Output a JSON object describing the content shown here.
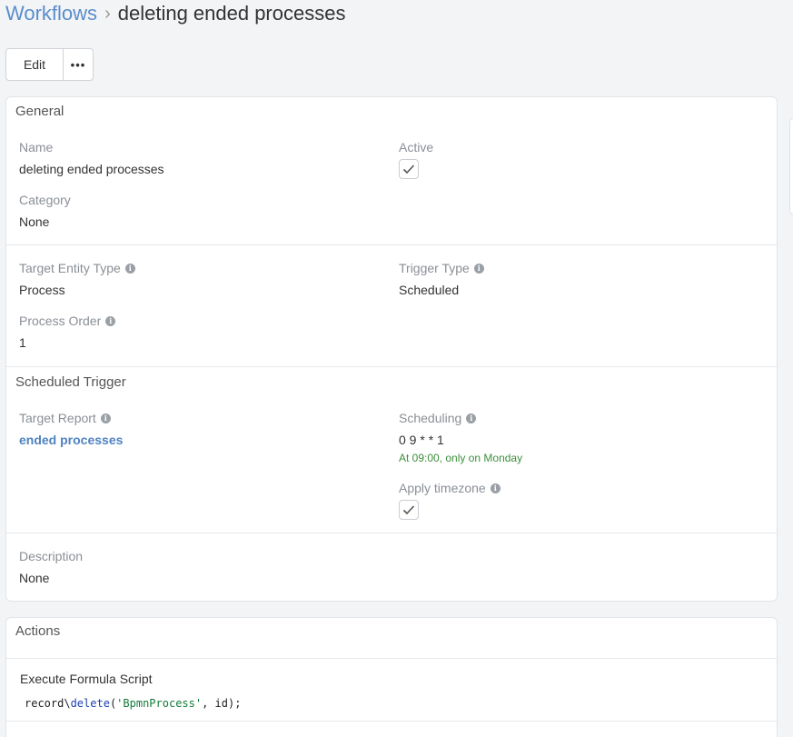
{
  "breadcrumb": {
    "root": "Workflows",
    "separator": "›",
    "current": "deleting ended processes"
  },
  "toolbar": {
    "edit_label": "Edit",
    "more_label": "•••"
  },
  "general": {
    "title": "General",
    "name_label": "Name",
    "name_value": "deleting ended processes",
    "active_label": "Active",
    "active_checked": true,
    "category_label": "Category",
    "category_value": "None",
    "target_entity_label": "Target Entity Type",
    "target_entity_value": "Process",
    "trigger_type_label": "Trigger Type",
    "trigger_type_value": "Scheduled",
    "process_order_label": "Process Order",
    "process_order_value": "1"
  },
  "scheduled": {
    "title": "Scheduled Trigger",
    "target_report_label": "Target Report",
    "target_report_value": "ended processes",
    "scheduling_label": "Scheduling",
    "scheduling_value": "0 9 * * 1",
    "scheduling_note": "At 09:00, only on Monday",
    "apply_tz_label": "Apply timezone",
    "apply_tz_checked": true,
    "description_label": "Description",
    "description_value": "None"
  },
  "actions": {
    "title": "Actions",
    "action_name": "Execute Formula Script",
    "code_prefix": "record\\",
    "code_fn": "delete",
    "code_open": "(",
    "code_str": "'BpmnProcess'",
    "code_rest": ", id);"
  },
  "icons": {
    "info": "info-icon",
    "check": "check-icon"
  },
  "colors": {
    "link": "#5a8dcc",
    "note_green": "#3c8f3c"
  }
}
